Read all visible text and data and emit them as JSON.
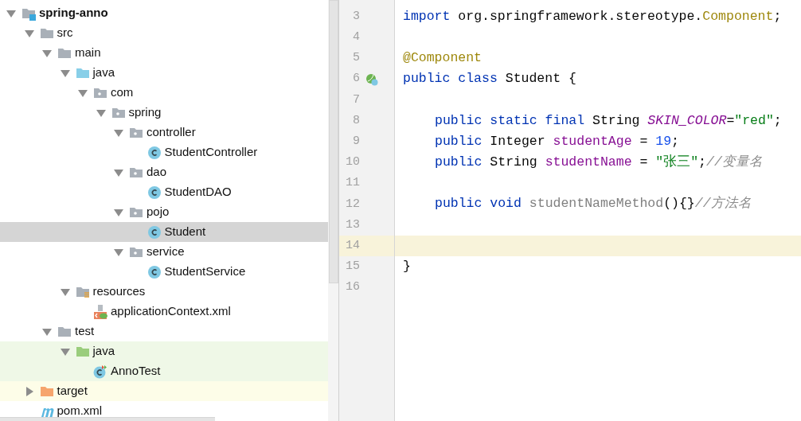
{
  "project_tree": [
    {
      "label": "spring-anno",
      "kind": "module",
      "expanded": true,
      "selected": false,
      "children": [
        {
          "label": "src",
          "kind": "folder",
          "expanded": true,
          "selected": false,
          "children": [
            {
              "label": "main",
              "kind": "folder",
              "expanded": true,
              "selected": false,
              "children": [
                {
                  "label": "java",
                  "kind": "source-folder",
                  "expanded": true,
                  "selected": false,
                  "children": [
                    {
                      "label": "com",
                      "kind": "package",
                      "expanded": true,
                      "selected": false,
                      "children": [
                        {
                          "label": "spring",
                          "kind": "package",
                          "expanded": true,
                          "selected": false,
                          "children": [
                            {
                              "label": "controller",
                              "kind": "package",
                              "expanded": true,
                              "selected": false,
                              "children": [
                                {
                                  "label": "StudentController",
                                  "kind": "class",
                                  "selected": false
                                }
                              ]
                            },
                            {
                              "label": "dao",
                              "kind": "package",
                              "expanded": true,
                              "selected": false,
                              "children": [
                                {
                                  "label": "StudentDAO",
                                  "kind": "class",
                                  "selected": false
                                }
                              ]
                            },
                            {
                              "label": "pojo",
                              "kind": "package",
                              "expanded": true,
                              "selected": false,
                              "children": [
                                {
                                  "label": "Student",
                                  "kind": "class",
                                  "selected": true
                                }
                              ]
                            },
                            {
                              "label": "service",
                              "kind": "package",
                              "expanded": true,
                              "selected": false,
                              "children": [
                                {
                                  "label": "StudentService",
                                  "kind": "class",
                                  "selected": false
                                }
                              ]
                            }
                          ]
                        }
                      ]
                    }
                  ]
                },
                {
                  "label": "resources",
                  "kind": "resources",
                  "expanded": true,
                  "selected": false,
                  "children": [
                    {
                      "label": "applicationContext.xml",
                      "kind": "spring-xml",
                      "selected": false
                    }
                  ]
                }
              ]
            },
            {
              "label": "test",
              "kind": "folder",
              "expanded": true,
              "selected": false,
              "children": [
                {
                  "label": "java",
                  "kind": "test-folder",
                  "expanded": true,
                  "selected": false,
                  "color": "#eff8e7",
                  "children": [
                    {
                      "label": "AnnoTest",
                      "kind": "test-class",
                      "selected": false,
                      "color": "#eff8e7"
                    }
                  ]
                }
              ]
            }
          ]
        },
        {
          "label": "target",
          "kind": "excluded-folder",
          "expanded": false,
          "selected": false,
          "color": "#fdfde8"
        },
        {
          "label": "pom.xml",
          "kind": "maven",
          "selected": false
        }
      ]
    }
  ],
  "editor": {
    "lines": [
      {
        "number": "3",
        "current": false,
        "bean_icon": false,
        "indented": false,
        "tokens": [
          {
            "t": "import",
            "kind": "keyword"
          },
          {
            "t": " org.springframework.stereotype.",
            "kind": "plain"
          },
          {
            "t": "Component",
            "kind": "annotation"
          },
          {
            "t": ";",
            "kind": "plain"
          }
        ]
      },
      {
        "number": "4",
        "current": false,
        "bean_icon": false
      },
      {
        "number": "5",
        "current": false,
        "bean_icon": false,
        "indented": false,
        "tokens": [
          {
            "t": "@Component",
            "kind": "annotation"
          }
        ]
      },
      {
        "number": "6",
        "current": false,
        "bean_icon": true,
        "indented": false,
        "tokens": [
          {
            "t": "public class",
            "kind": "keyword"
          },
          {
            "t": " Student {",
            "kind": "plain"
          }
        ]
      },
      {
        "number": "7",
        "current": false,
        "bean_icon": false
      },
      {
        "number": "8",
        "current": false,
        "bean_icon": false,
        "indented": true,
        "tokens": [
          {
            "t": "public static final",
            "kind": "keyword"
          },
          {
            "t": " String ",
            "kind": "plain"
          },
          {
            "t": "SKIN_COLOR",
            "kind": "static-field"
          },
          {
            "t": "=",
            "kind": "plain"
          },
          {
            "t": "\"red\"",
            "kind": "string"
          },
          {
            "t": ";",
            "kind": "plain"
          }
        ]
      },
      {
        "number": "9",
        "current": false,
        "bean_icon": false,
        "indented": true,
        "tokens": [
          {
            "t": "public",
            "kind": "keyword"
          },
          {
            "t": " Integer ",
            "kind": "plain"
          },
          {
            "t": "studentAge",
            "kind": "field"
          },
          {
            "t": " = ",
            "kind": "plain"
          },
          {
            "t": "19",
            "kind": "number"
          },
          {
            "t": ";",
            "kind": "plain"
          }
        ]
      },
      {
        "number": "10",
        "current": false,
        "bean_icon": false,
        "indented": true,
        "tokens": [
          {
            "t": "public",
            "kind": "keyword"
          },
          {
            "t": " String ",
            "kind": "plain"
          },
          {
            "t": "studentName",
            "kind": "field"
          },
          {
            "t": " = ",
            "kind": "plain"
          },
          {
            "t": "\"张三\"",
            "kind": "string"
          },
          {
            "t": ";",
            "kind": "plain"
          },
          {
            "t": "//变量名",
            "kind": "comment"
          }
        ]
      },
      {
        "number": "11",
        "current": false,
        "bean_icon": false
      },
      {
        "number": "12",
        "current": false,
        "bean_icon": false,
        "indented": true,
        "tokens": [
          {
            "t": "public void ",
            "kind": "keyword"
          },
          {
            "t": "studentNameMethod",
            "kind": "unused"
          },
          {
            "t": "(){}",
            "kind": "plain"
          },
          {
            "t": "//方法名",
            "kind": "comment"
          }
        ]
      },
      {
        "number": "13",
        "current": false,
        "bean_icon": false
      },
      {
        "number": "14",
        "current": true,
        "bean_icon": false
      },
      {
        "number": "15",
        "current": false,
        "bean_icon": false,
        "indented": false,
        "tokens": [
          {
            "t": "}",
            "kind": "plain"
          }
        ]
      },
      {
        "number": "16",
        "current": false,
        "bean_icon": false
      }
    ]
  }
}
